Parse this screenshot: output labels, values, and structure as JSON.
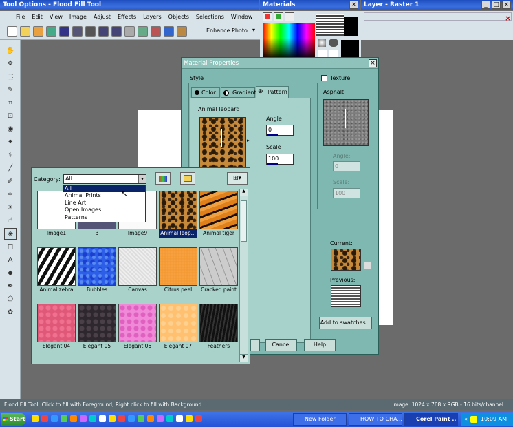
{
  "main_window": {
    "title": "Tool Options - Flood Fill Tool",
    "menu": [
      "File",
      "Edit",
      "View",
      "Image",
      "Adjust",
      "Effects",
      "Layers",
      "Objects",
      "Selections",
      "Window"
    ],
    "enhance_photo": "Enhance Photo"
  },
  "materials_palette": {
    "title": "Materials"
  },
  "layer_palette": {
    "title": "Layer - Raster 1"
  },
  "dialog": {
    "title": "Material Properties",
    "style_label": "Style",
    "tabs": [
      "Color",
      "Gradient",
      "Pattern"
    ],
    "pattern_name": "Animal leopard",
    "angle_label": "Angle",
    "angle_value": "0",
    "scale_label": "Scale",
    "scale_value": "100",
    "texture_label": "Texture",
    "texture_name": "Asphalt",
    "tex_angle_label": "Angle:",
    "tex_angle_value": "0",
    "tex_scale_label": "Scale:",
    "tex_scale_value": "100",
    "current_label": "Current:",
    "previous_label": "Previous:",
    "add_swatches": "Add to swatches...",
    "cancel": "Cancel",
    "help": "Help"
  },
  "browser": {
    "category_label": "Category:",
    "category_value": "All",
    "options": [
      "All",
      "Animal Prints",
      "Line Art",
      "Open Images",
      "Patterns"
    ],
    "items": [
      {
        "label": "Image1",
        "kind": "image1"
      },
      {
        "label": "3",
        "kind": "photo"
      },
      {
        "label": "Image9",
        "kind": "white"
      },
      {
        "label": "Animal leop...",
        "kind": "leopard",
        "selected": true
      },
      {
        "label": "Animal tiger",
        "kind": "tiger"
      },
      {
        "label": "Animal zebra",
        "kind": "zebra"
      },
      {
        "label": "Bubbles",
        "kind": "bubbles"
      },
      {
        "label": "Canvas",
        "kind": "canvas"
      },
      {
        "label": "Citrus peel",
        "kind": "citrus"
      },
      {
        "label": "Cracked paint",
        "kind": "cracked"
      },
      {
        "label": "Elegant 04",
        "kind": "el04"
      },
      {
        "label": "Elegant 05",
        "kind": "el05"
      },
      {
        "label": "Elegant 06",
        "kind": "el06"
      },
      {
        "label": "Elegant 07",
        "kind": "el07"
      },
      {
        "label": "Feathers",
        "kind": "feathers"
      }
    ]
  },
  "status": {
    "left": "Flood Fill Tool: Click to fill with Foreground, Right click to fill with Background.",
    "right": "Image:  1024 x 768 x RGB - 16 bits/channel"
  },
  "taskbar": {
    "start": "Start",
    "tasks": [
      "New Folder",
      "HOW TO CHA...",
      "Corel Paint ..."
    ],
    "clock": "10:09 AM"
  },
  "colors": {
    "titlebar": "#2a58c8",
    "dialog": "#7fb8b0",
    "workspace": "#6b6b6b",
    "taskbar": "#2452d8"
  }
}
